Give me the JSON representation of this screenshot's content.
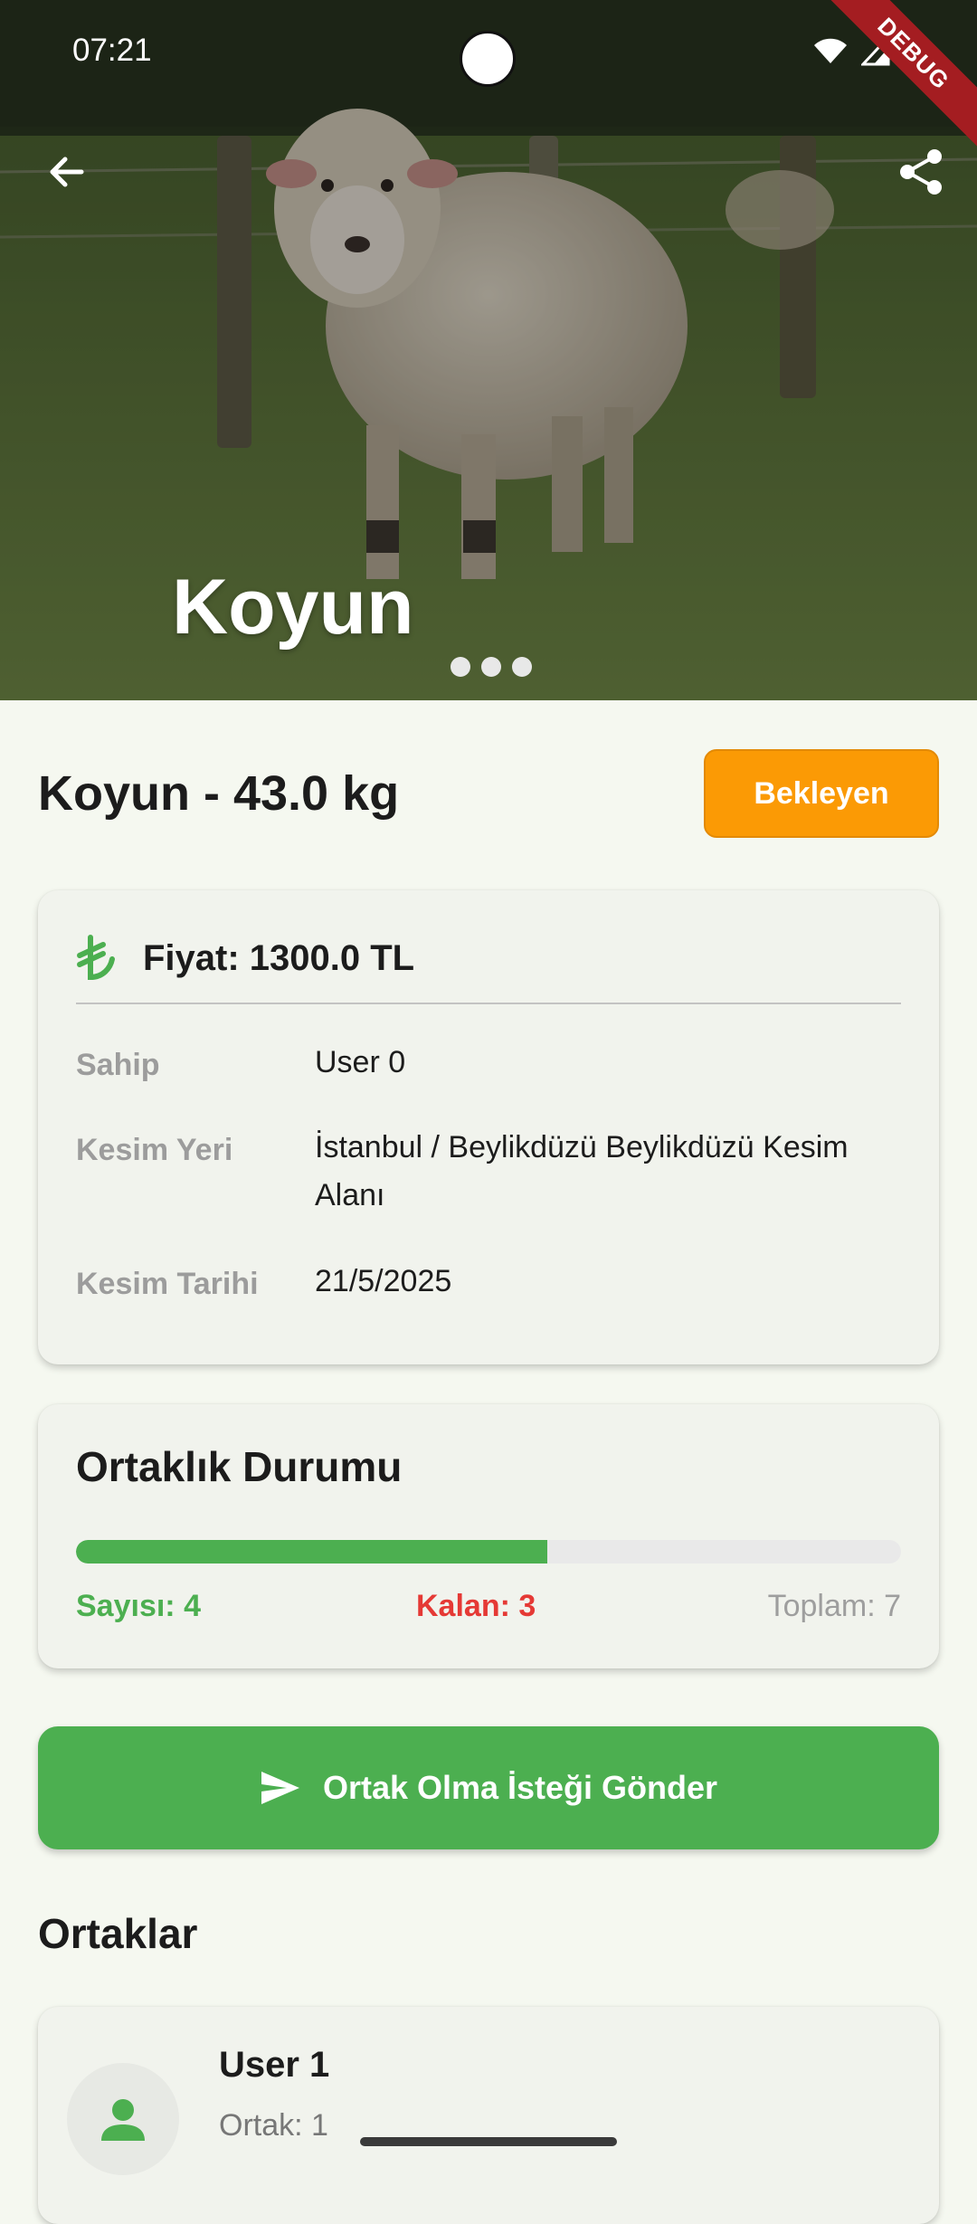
{
  "status_bar": {
    "time": "07:21",
    "debug_label": "DEBUG"
  },
  "hero": {
    "title": "Koyun",
    "image_subject": "sheep-photo",
    "slide_count": 3,
    "back_icon": "arrow-back-icon",
    "share_icon": "share-icon"
  },
  "header": {
    "title": "Koyun - 43.0 kg",
    "status_label": "Bekleyen"
  },
  "details": {
    "price_icon": "lira-icon",
    "price": "Fiyat: 1300.0 TL",
    "rows": [
      {
        "label": "Sahip",
        "value": "User 0"
      },
      {
        "label": "Kesim Yeri",
        "value": "İstanbul / Beylikdüzü Beylikdüzü Kesim Alanı"
      },
      {
        "label": "Kesim Tarihi",
        "value": "21/5/2025"
      }
    ]
  },
  "partnership": {
    "title": "Ortaklık Durumu",
    "progress_fraction": 0.5714,
    "count_label": "Sayısı: 4",
    "remaining_label": "Kalan: 3",
    "total_label": "Toplam: 7"
  },
  "actions": {
    "send_request_label": "Ortak Olma İsteği Gönder",
    "send_icon": "send-icon"
  },
  "partners": {
    "section_title": "Ortaklar",
    "items": [
      {
        "name": "User 1",
        "share_label": "Ortak: 1",
        "avatar_icon": "person-icon"
      }
    ]
  },
  "colors": {
    "primary_green": "#4caf50",
    "pending_orange": "#fb9a05",
    "remaining_red": "#e53935",
    "background": "#f5f8f0"
  }
}
